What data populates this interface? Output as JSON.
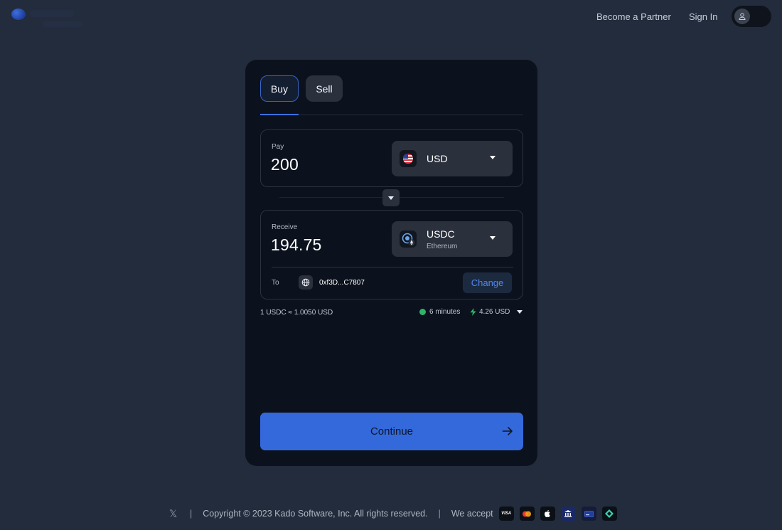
{
  "header": {
    "partner_link": "Become a Partner",
    "signin_link": "Sign In"
  },
  "tabs": [
    {
      "label": "Buy",
      "active": true
    },
    {
      "label": "Sell",
      "active": false
    }
  ],
  "pay": {
    "label": "Pay",
    "amount": "200",
    "currency": "USD",
    "currency_icon": "us-flag-icon"
  },
  "receive": {
    "label": "Receive",
    "amount": "194.75",
    "currency": "USDC",
    "network": "Ethereum",
    "currency_icon": "usdc-icon"
  },
  "destination": {
    "label": "To",
    "address": "0xf3D...C7807",
    "change_label": "Change"
  },
  "quote": {
    "rate": "1 USDC ≈ 1.0050 USD",
    "eta": "6 minutes",
    "fee": "4.26 USD"
  },
  "continue_label": "Continue",
  "footer": {
    "copyright": "Copyright © 2023 Kado Software, Inc. All rights reserved.",
    "accept_label": "We accept",
    "payment_methods": [
      "visa-icon",
      "mastercard-icon",
      "apple-pay-icon",
      "bank-icon",
      "debit-card-icon",
      "diamond-icon"
    ],
    "visa_text": "VISA"
  },
  "colors": {
    "background": "#222c3c",
    "card": "#0c121d",
    "accent": "#3469db",
    "link": "#4f87ee",
    "eta_green": "#2fb56a"
  }
}
